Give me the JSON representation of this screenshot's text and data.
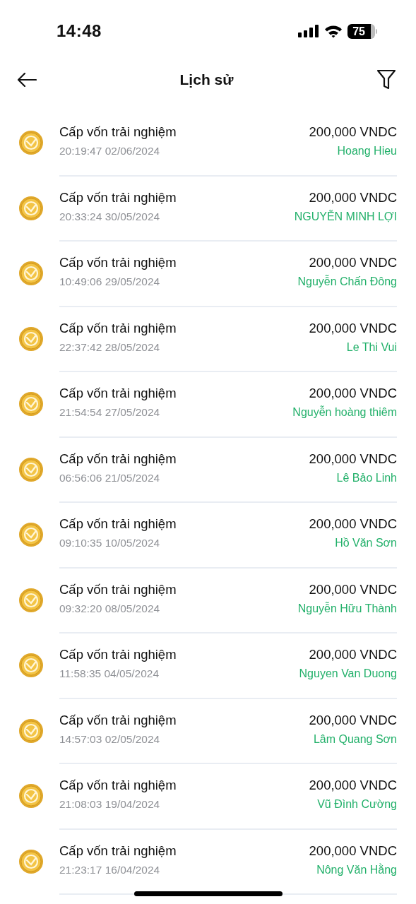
{
  "status_bar": {
    "time": "14:48",
    "battery": "75"
  },
  "header": {
    "title": "Lịch sử"
  },
  "transactions": [
    {
      "title": "Cấp vốn trải nghiệm",
      "time": "20:19:47 02/06/2024",
      "amount": "200,000 VNDC",
      "name": "Hoang Hieu"
    },
    {
      "title": "Cấp vốn trải nghiệm",
      "time": "20:33:24 30/05/2024",
      "amount": "200,000 VNDC",
      "name": "NGUYỄN MINH LỢI"
    },
    {
      "title": "Cấp vốn trải nghiệm",
      "time": "10:49:06 29/05/2024",
      "amount": "200,000 VNDC",
      "name": "Nguyễn Chấn Đông"
    },
    {
      "title": "Cấp vốn trải nghiệm",
      "time": "22:37:42 28/05/2024",
      "amount": "200,000 VNDC",
      "name": "Le Thi Vui"
    },
    {
      "title": "Cấp vốn trải nghiệm",
      "time": "21:54:54 27/05/2024",
      "amount": "200,000 VNDC",
      "name": "Nguyễn hoàng thiêm"
    },
    {
      "title": "Cấp vốn trải nghiệm",
      "time": "06:56:06 21/05/2024",
      "amount": "200,000 VNDC",
      "name": "Lê Bảo Linh"
    },
    {
      "title": "Cấp vốn trải nghiệm",
      "time": "09:10:35 10/05/2024",
      "amount": "200,000 VNDC",
      "name": "Hồ Văn Sơn"
    },
    {
      "title": "Cấp vốn trải nghiệm",
      "time": "09:32:20 08/05/2024",
      "amount": "200,000 VNDC",
      "name": "Nguyễn Hữu Thành"
    },
    {
      "title": "Cấp vốn trải nghiệm",
      "time": "11:58:35 04/05/2024",
      "amount": "200,000 VNDC",
      "name": "Nguyen Van Duong"
    },
    {
      "title": "Cấp vốn trải nghiệm",
      "time": "14:57:03 02/05/2024",
      "amount": "200,000 VNDC",
      "name": "Lâm Quang Sơn"
    },
    {
      "title": "Cấp vốn trải nghiệm",
      "time": "21:08:03 19/04/2024",
      "amount": "200,000 VNDC",
      "name": "Vũ Đình Cường"
    },
    {
      "title": "Cấp vốn trải nghiệm",
      "time": "21:23:17 16/04/2024",
      "amount": "200,000 VNDC",
      "name": "Nông Văn Hằng"
    }
  ]
}
